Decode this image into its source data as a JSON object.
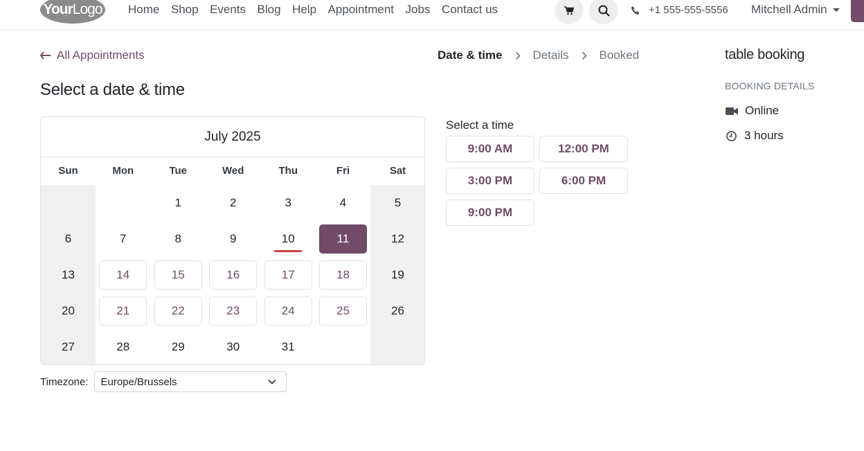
{
  "header": {
    "logo_your": "Your",
    "logo_logo": "Logo",
    "nav": [
      "Home",
      "Shop",
      "Events",
      "Blog",
      "Help",
      "Appointment",
      "Jobs",
      "Contact us"
    ],
    "phone": "+1 555-555-5556",
    "user": "Mitchell Admin",
    "icons": {
      "cart": "cart-icon",
      "search": "search-icon",
      "phone": "phone-icon"
    }
  },
  "back_link": "All Appointments",
  "steps": [
    "Date & time",
    "Details",
    "Booked"
  ],
  "page_title": "Select a date & time",
  "calendar": {
    "month": "July 2025",
    "weekdays": [
      "Sun",
      "Mon",
      "Tue",
      "Wed",
      "Thu",
      "Fri",
      "Sat"
    ],
    "weeks": [
      [
        "",
        "",
        "1",
        "2",
        "3",
        "4",
        "5"
      ],
      [
        "6",
        "7",
        "8",
        "9",
        "10",
        "11",
        "12"
      ],
      [
        "13",
        "14",
        "15",
        "16",
        "17",
        "18",
        "19"
      ],
      [
        "20",
        "21",
        "22",
        "23",
        "24",
        "25",
        "26"
      ],
      [
        "27",
        "28",
        "29",
        "30",
        "31",
        "",
        ""
      ]
    ],
    "available_days": [
      "11",
      "14",
      "15",
      "16",
      "17",
      "18",
      "21",
      "22",
      "23",
      "24",
      "25"
    ],
    "selected_day": "11",
    "today": "10"
  },
  "timezone": {
    "label": "Timezone:",
    "value": "Europe/Brussels"
  },
  "times": {
    "label": "Select a time",
    "slots": [
      "9:00 AM",
      "12:00 PM",
      "3:00 PM",
      "6:00 PM",
      "9:00 PM"
    ]
  },
  "booking": {
    "title": "table booking",
    "section_label": "BOOKING DETAILS",
    "location": "Online",
    "duration": "3 hours"
  },
  "colors": {
    "accent": "#714b67",
    "today_underline": "#d9394a",
    "weekend_bg": "#f0f0f0"
  }
}
